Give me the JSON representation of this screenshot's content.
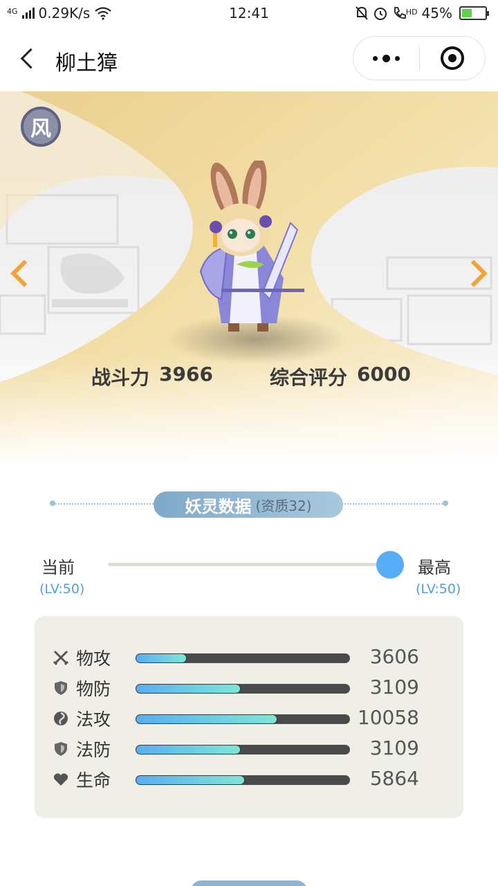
{
  "status_bar": {
    "network": "4G",
    "speed": "0.29K/s",
    "time": "12:41",
    "hd": "HD",
    "battery": "45%"
  },
  "nav": {
    "title": "柳土獐"
  },
  "hero": {
    "element_badge": "风",
    "power_label": "战斗力",
    "power_value": "3966",
    "score_label": "综合评分",
    "score_value": "6000"
  },
  "section": {
    "title": "妖灵数据",
    "subtitle": "(资质32)"
  },
  "level": {
    "current_label": "当前",
    "current_level": "(LV:50)",
    "max_label": "最高",
    "max_level": "(LV:50)",
    "slider_fraction": 1.0
  },
  "stats": [
    {
      "icon": "swords-icon",
      "name": "物攻",
      "value": "3606",
      "fraction": 0.24
    },
    {
      "icon": "shield-icon",
      "name": "物防",
      "value": "3109",
      "fraction": 0.49
    },
    {
      "icon": "swirl-icon",
      "name": "法攻",
      "value": "10058",
      "fraction": 0.66
    },
    {
      "icon": "shield-icon",
      "name": "法防",
      "value": "3109",
      "fraction": 0.49
    },
    {
      "icon": "heart-icon",
      "name": "生命",
      "value": "5864",
      "fraction": 0.51
    }
  ],
  "colors": {
    "accent_gold": "#f1a33a",
    "slider_blue": "#58aef6",
    "level_blue": "#4e9fe0",
    "panel_bg": "#f0efe7"
  }
}
